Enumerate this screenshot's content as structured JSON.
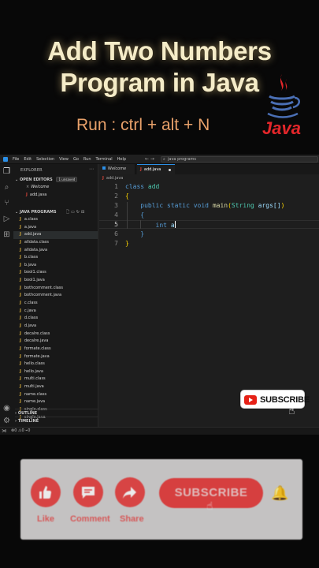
{
  "header": {
    "title_line1": "Add Two Numbers",
    "title_line2": "Program in Java",
    "run_hint": "Run : ctrl + alt + N",
    "logo_word": "Java"
  },
  "window": {
    "menus": [
      "File",
      "Edit",
      "Selection",
      "View",
      "Go",
      "Run",
      "Terminal",
      "Help"
    ],
    "nav_arrows": "← →",
    "search_text": "java programs"
  },
  "sidebar": {
    "title": "EXPLORER",
    "open_editors_label": "OPEN EDITORS",
    "unsaved_badge": "1 unsaved",
    "open_editors": [
      {
        "name": "Welcome"
      },
      {
        "name": "add.java"
      }
    ],
    "folder_label": "JAVA PROGRAMS",
    "files": [
      "a.class",
      "a.java",
      "add.java",
      "alldata.class",
      "alldata.java",
      "b.class",
      "b.java",
      "bool1.class",
      "bool1.java",
      "bothcomment.class",
      "bothcomment.java",
      "c.class",
      "c.java",
      "d.class",
      "d.java",
      "decalre.class",
      "decalre.java",
      "formate.class",
      "formate.java",
      "hello.class",
      "hello.java",
      "multi.class",
      "multi.java",
      "name.class",
      "name.java",
      "single.class",
      "single.java"
    ],
    "outline_label": "OUTLINE",
    "timeline_label": "TIMELINE"
  },
  "tabs": [
    {
      "label": "Welcome"
    },
    {
      "label": "add.java"
    }
  ],
  "breadcrumb": "add.java",
  "editor": {
    "line_numbers": [
      "1",
      "2",
      "3",
      "4",
      "5",
      "6",
      "7"
    ],
    "kw_class": "class",
    "class_name": "add",
    "brace_open": "{",
    "brace_close": "}",
    "kw_public": "public",
    "kw_static": "static",
    "kw_void": "void",
    "method_name": "main",
    "paren_open": "(",
    "param_type": "String",
    "param_name": "args[]",
    "paren_close": ")",
    "kw_int": "int",
    "var_a": "a"
  },
  "status": {
    "stats": "⊗0 ⚠0   ⌁0"
  },
  "subscribe_badge": "SUBSCRIBE",
  "overlay": {
    "like_label": "Like",
    "comment_label": "Comment",
    "share_label": "Share",
    "subscribe_label": "SUBSCRIBE"
  },
  "colors": {
    "title": "#f5ecc8",
    "run_hint": "#e8a16a",
    "accent_red": "#e84444",
    "vscode_bg": "#1e1e1e",
    "keyword": "#569cd6"
  }
}
